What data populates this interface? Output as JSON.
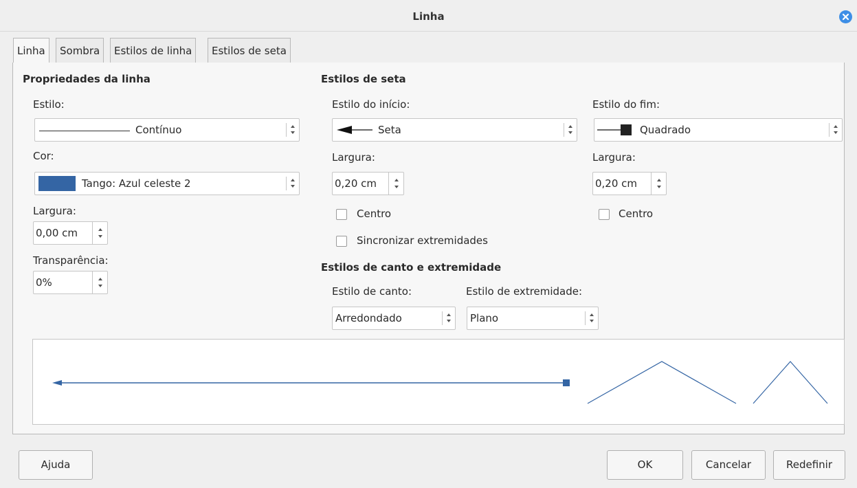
{
  "window": {
    "title": "Linha"
  },
  "tabs": [
    {
      "label": "Linha",
      "active": true
    },
    {
      "label": "Sombra"
    },
    {
      "label": "Estilos de linha"
    },
    {
      "label": "Estilos de seta"
    }
  ],
  "line_properties": {
    "heading": "Propriedades da linha",
    "style_label": "Estilo:",
    "style_value": "Contínuo",
    "color_label": "Cor:",
    "color_value": "Tango: Azul celeste 2",
    "color_swatch": "#3465a4",
    "width_label": "Largura:",
    "width_value": "0,00 cm",
    "transparency_label": "Transparência:",
    "transparency_value": "0%"
  },
  "arrow_styles": {
    "heading": "Estilos de seta",
    "start_label": "Estilo do início:",
    "start_value": "Seta",
    "end_label": "Estilo do fim:",
    "end_value": "Quadrado",
    "start_width_label": "Largura:",
    "start_width_value": "0,20 cm",
    "end_width_label": "Largura:",
    "end_width_value": "0,20 cm",
    "start_center_label": "Centro",
    "end_center_label": "Centro",
    "sync_label": "Sincronizar extremidades"
  },
  "corner_cap": {
    "heading": "Estilos de canto e extremidade",
    "corner_label": "Estilo de canto:",
    "corner_value": "Arredondado",
    "cap_label": "Estilo de extremidade:",
    "cap_value": "Plano"
  },
  "buttons": {
    "help": "Ajuda",
    "ok": "OK",
    "cancel": "Cancelar",
    "reset": "Redefinir"
  },
  "colors": {
    "accent": "#3465a4",
    "close": "#3d8ee6"
  }
}
